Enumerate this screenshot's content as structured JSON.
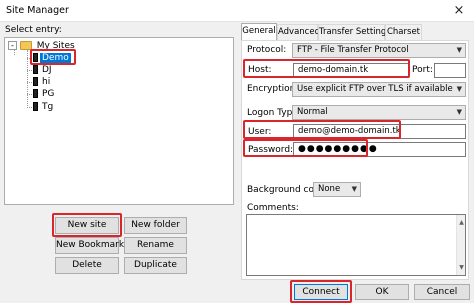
{
  "window": {
    "title": "Site Manager",
    "close_glyph": "×"
  },
  "left": {
    "select_entry_label": "Select entry:",
    "tree": {
      "root_label": "My Sites",
      "root_toggle": "-",
      "sites": [
        "Demo",
        "DJ",
        "hi",
        "PG",
        "Tg"
      ],
      "selected": "Demo"
    },
    "buttons": {
      "new_site": "New site",
      "new_folder": "New folder",
      "new_bookmark": "New Bookmark",
      "rename": "Rename",
      "delete": "Delete",
      "duplicate": "Duplicate"
    }
  },
  "tabs": [
    "General",
    "Advanced",
    "Transfer Settings",
    "Charset"
  ],
  "active_tab": "General",
  "general": {
    "protocol_label": "Protocol:",
    "protocol_value": "FTP - File Transfer Protocol",
    "host_label": "Host:",
    "host_value": "demo-domain.tk",
    "port_label": "Port:",
    "port_value": "",
    "encryption_label": "Encryption:",
    "encryption_value": "Use explicit FTP over TLS if available",
    "logon_type_label": "Logon Type:",
    "logon_type_value": "Normal",
    "user_label": "User:",
    "user_value": "demo@demo-domain.tk",
    "password_label": "Password:",
    "password_value": "●●●●●●●●●",
    "background_color_label": "Background color:",
    "background_color_value": "None",
    "comments_label": "Comments:",
    "comments_value": ""
  },
  "footer": {
    "connect": "Connect",
    "ok": "OK",
    "cancel": "Cancel"
  },
  "colors": {
    "highlight": "#d9262c",
    "selection": "#0078d7",
    "folder": "#f3c65a"
  },
  "icons": {
    "folder": "folder-icon",
    "site": "server-icon",
    "dropdown": "chevron-down-icon",
    "close": "close-icon"
  }
}
